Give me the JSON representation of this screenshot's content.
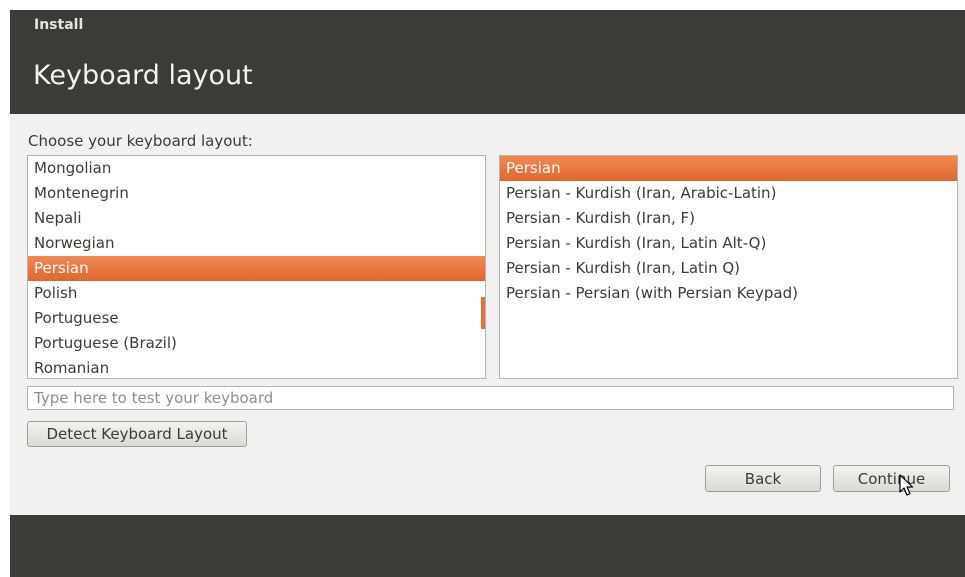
{
  "window": {
    "title": "Install"
  },
  "header": {
    "title": "Keyboard layout"
  },
  "main": {
    "prompt": "Choose your keyboard layout:",
    "layouts": [
      "Mongolian",
      "Montenegrin",
      "Nepali",
      "Norwegian",
      "Persian",
      "Polish",
      "Portuguese",
      "Portuguese (Brazil)",
      "Romanian"
    ],
    "selected_layout": "Persian",
    "variants": [
      "Persian",
      "Persian - Kurdish (Iran, Arabic-Latin)",
      "Persian - Kurdish (Iran, F)",
      "Persian - Kurdish (Iran, Latin Alt-Q)",
      "Persian - Kurdish (Iran, Latin Q)",
      "Persian - Persian (with Persian Keypad)"
    ],
    "selected_variant": "Persian",
    "test_placeholder": "Type here to test your keyboard",
    "detect_label": "Detect Keyboard Layout"
  },
  "footer": {
    "back_label": "Back",
    "continue_label": "Continue"
  },
  "colors": {
    "accent": "#e96f35",
    "chrome": "#3c3b37",
    "panel": "#f2f1f0"
  },
  "icons": {
    "cursor": "pointer-cursor-icon"
  }
}
